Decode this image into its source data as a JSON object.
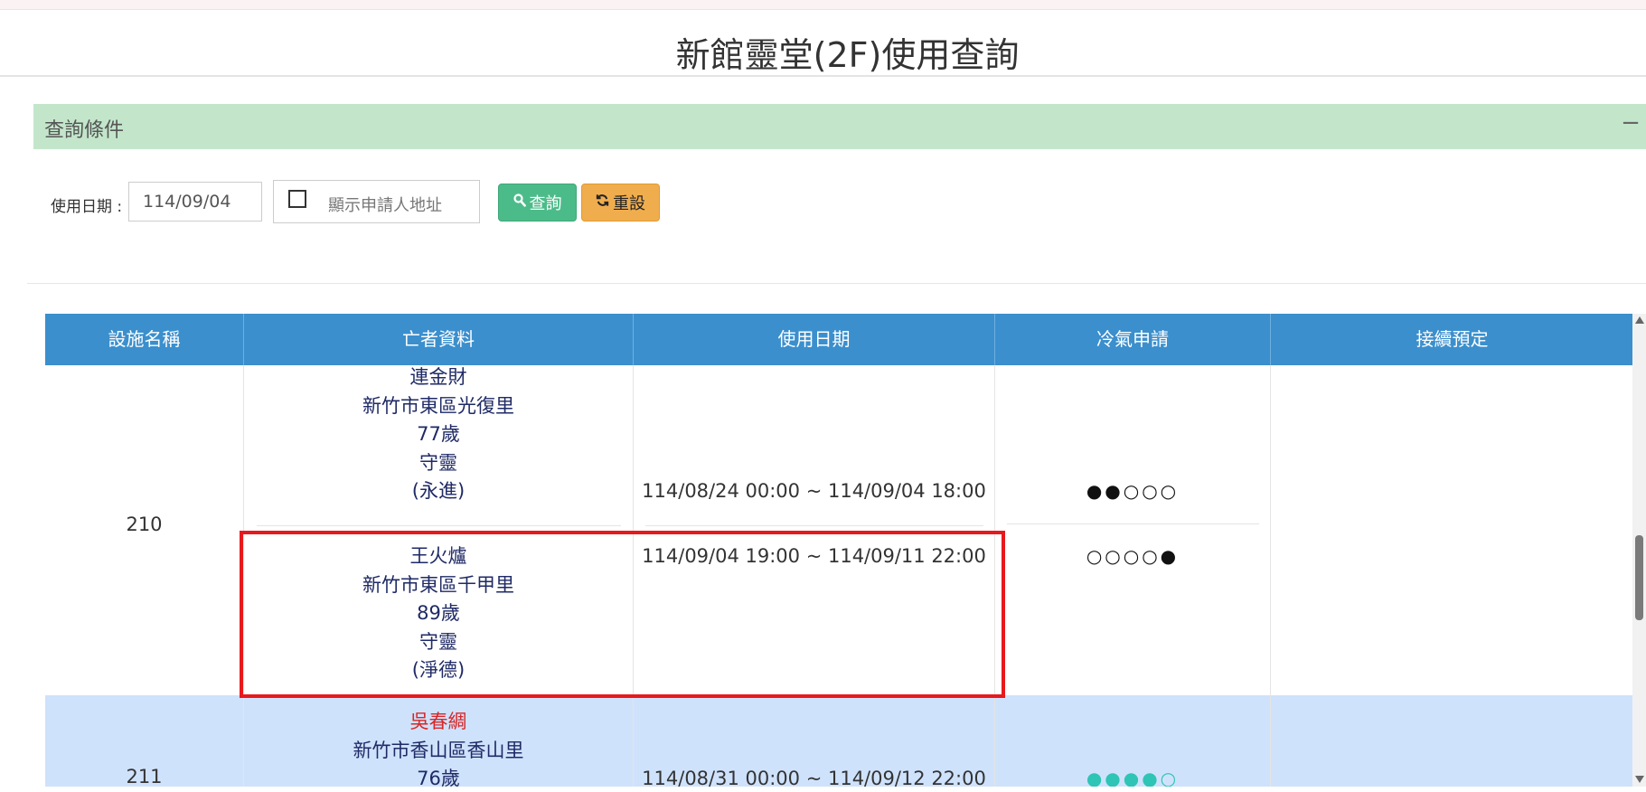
{
  "page": {
    "title": "新館靈堂(2F)使用查詢"
  },
  "query_panel": {
    "title": "查詢條件",
    "collapse_symbol": "−",
    "date_label": "使用日期 :",
    "date_value": "114/09/04",
    "show_address_label": "顯示申請人地址",
    "show_address_checked": false,
    "search_button": "查詢",
    "reset_button": "重設"
  },
  "table": {
    "headers": [
      "設施名稱",
      "亡者資料",
      "使用日期",
      "冷氣申請",
      "接續預定"
    ],
    "rows": [
      {
        "facility": "210",
        "entries": [
          {
            "name": "連金財",
            "address": "新竹市東區光復里",
            "age": "77歲",
            "type": "守靈",
            "note": "(永進)",
            "period": "114/08/24 00:00 ~ 114/09/04 18:00",
            "ac": "●●○○○",
            "highlighted": false
          },
          {
            "name": "王火爐",
            "address": "新竹市東區千甲里",
            "age": "89歲",
            "type": "守靈",
            "note": "(淨德)",
            "period": "114/09/04 19:00 ~ 114/09/11 22:00",
            "ac": "○○○○●",
            "highlighted": true
          }
        ]
      },
      {
        "facility": "211",
        "entries": [
          {
            "name": "吳春綢",
            "address": "新竹市香山區香山里",
            "age": "76歲",
            "period": "114/08/31 00:00 ~ 114/09/12 22:00",
            "ac": "●●●●○"
          }
        ]
      }
    ]
  },
  "colors": {
    "header_blue": "#3b8fcd",
    "panel_green": "#c3e6cb",
    "search_green": "#4cbb8a",
    "reset_orange": "#f0ad4e",
    "highlight_red": "#e8191c",
    "name_red": "#d62828",
    "ac_teal": "#2ec4b6"
  },
  "icons": {
    "search": "search-icon",
    "reset": "refresh-icon"
  }
}
